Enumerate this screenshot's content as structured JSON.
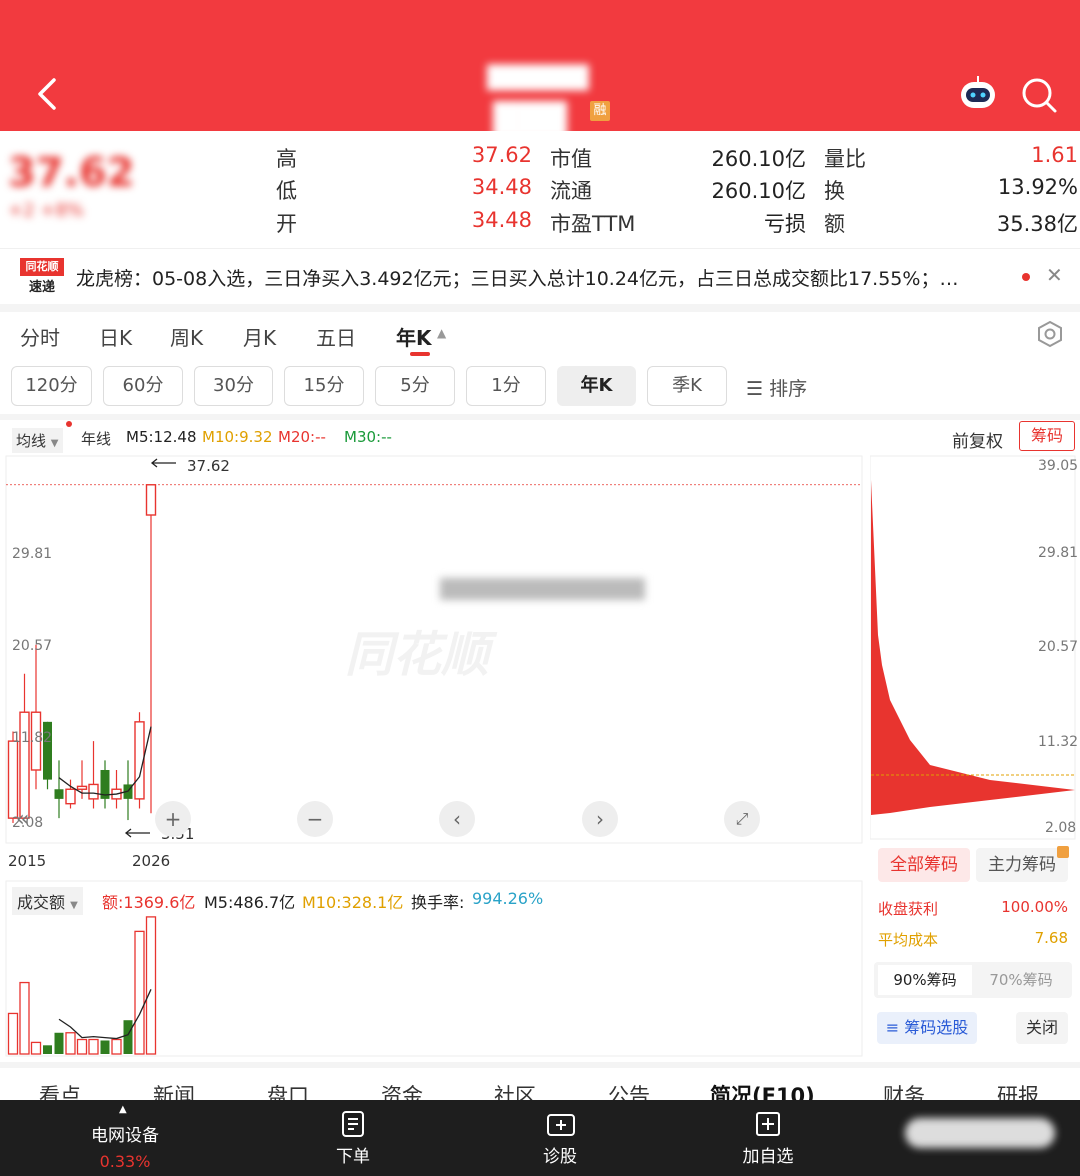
{
  "header": {
    "title": "██████",
    "subtitle": "██████ ██████",
    "badge": "融"
  },
  "quote": {
    "price": "37.62",
    "change": "+2 +8%",
    "rows": [
      {
        "l1": "高",
        "v1": "37.62",
        "l2": "市值",
        "v2": "260.10亿",
        "l3": "量比",
        "v3": "1.61"
      },
      {
        "l1": "低",
        "v1": "34.48",
        "l2": "流通",
        "v2": "260.10亿",
        "l3": "换",
        "v3": "13.92%"
      },
      {
        "l1": "开",
        "v1": "34.48",
        "l2": "市盈TTM",
        "v2": "亏损",
        "l3": "额",
        "v3": "35.38亿"
      }
    ]
  },
  "news": {
    "logo_top": "同花顺",
    "logo_bottom": "速递",
    "text": "龙虎榜：05-08入选，三日净买入3.492亿元；三日买入总计10.24亿元，占三日总成交额比17.55%；…"
  },
  "period_tabs": [
    "分时",
    "日K",
    "周K",
    "月K",
    "五日",
    "年K"
  ],
  "interval_chips": [
    "120分",
    "60分",
    "30分",
    "15分",
    "5分",
    "1分",
    "年K",
    "季K"
  ],
  "sort_label": "☰ 排序",
  "indicator": {
    "ma_label": "均线",
    "period": "年线",
    "m5": "M5:12.48",
    "m10": "M10:9.32",
    "m20": "M20:--",
    "m30": "M30:--",
    "adjust": "前复权",
    "chips_btn": "筹码"
  },
  "kline": {
    "high_label": "37.62",
    "low_label": "3.51",
    "y_ticks": [
      "39.05",
      "29.81",
      "20.57",
      "11.82",
      "2.08"
    ],
    "x_start": "2015",
    "x_end": "2026",
    "watermark": "同花顺"
  },
  "chip_panel": {
    "y_ticks": [
      "39.05",
      "29.81",
      "20.57",
      "11.32",
      "2.08"
    ],
    "tab_all": "全部筹码",
    "tab_main": "主力筹码",
    "profit_label": "收盘获利",
    "profit_value": "100.00%",
    "cost_label": "平均成本",
    "cost_value": "7.68",
    "pct90": "90%筹码",
    "pct70": "70%筹码",
    "select_btn": "筹码选股",
    "close_btn": "关闭"
  },
  "volume": {
    "label": "成交额",
    "amount": "额:1369.6亿",
    "m5": "M5:486.7亿",
    "m10": "M10:328.1亿",
    "turnover_label": "换手率:",
    "turnover": "994.26%"
  },
  "bottom_tabs": [
    "看点",
    "新闻",
    "盘口",
    "资金",
    "社区",
    "公告",
    "简况(F10)",
    "财务",
    "研报"
  ],
  "nav": {
    "sector": "电网设备",
    "sector_change": "0.33%",
    "items": [
      "下单",
      "诊股",
      "加自选"
    ]
  },
  "chart_data": {
    "type": "candlestick",
    "x_range": [
      "2015",
      "2026"
    ],
    "ylim": [
      2.08,
      39.05
    ],
    "candles": [
      {
        "o": 11,
        "c": 3,
        "h": 12,
        "l": 2.5,
        "dir": "up"
      },
      {
        "o": 3,
        "c": 14,
        "h": 18,
        "l": 3,
        "dir": "up"
      },
      {
        "o": 14,
        "c": 8,
        "h": 21,
        "l": 6,
        "dir": "up"
      },
      {
        "o": 13,
        "c": 7,
        "h": 13,
        "l": 6,
        "dir": "down"
      },
      {
        "o": 6,
        "c": 5,
        "h": 9,
        "l": 3,
        "dir": "down"
      },
      {
        "o": 4.5,
        "c": 6,
        "h": 7,
        "l": 4,
        "dir": "up"
      },
      {
        "o": 6,
        "c": 6.3,
        "h": 9,
        "l": 5,
        "dir": "up"
      },
      {
        "o": 6.5,
        "c": 5,
        "h": 11,
        "l": 4,
        "dir": "up"
      },
      {
        "o": 8,
        "c": 5,
        "h": 9,
        "l": 4,
        "dir": "down"
      },
      {
        "o": 5,
        "c": 6,
        "h": 8,
        "l": 4,
        "dir": "up"
      },
      {
        "o": 5,
        "c": 6.5,
        "h": 9,
        "l": 2.8,
        "dir": "down"
      },
      {
        "o": 5,
        "c": 13,
        "h": 14,
        "l": 4,
        "dir": "up"
      },
      {
        "o": 34.48,
        "c": 37.62,
        "h": 37.62,
        "l": 3.51,
        "dir": "up"
      }
    ],
    "volumes": [
      42,
      74,
      12,
      9,
      22,
      22,
      15,
      15,
      14,
      15,
      35,
      127,
      142
    ]
  }
}
